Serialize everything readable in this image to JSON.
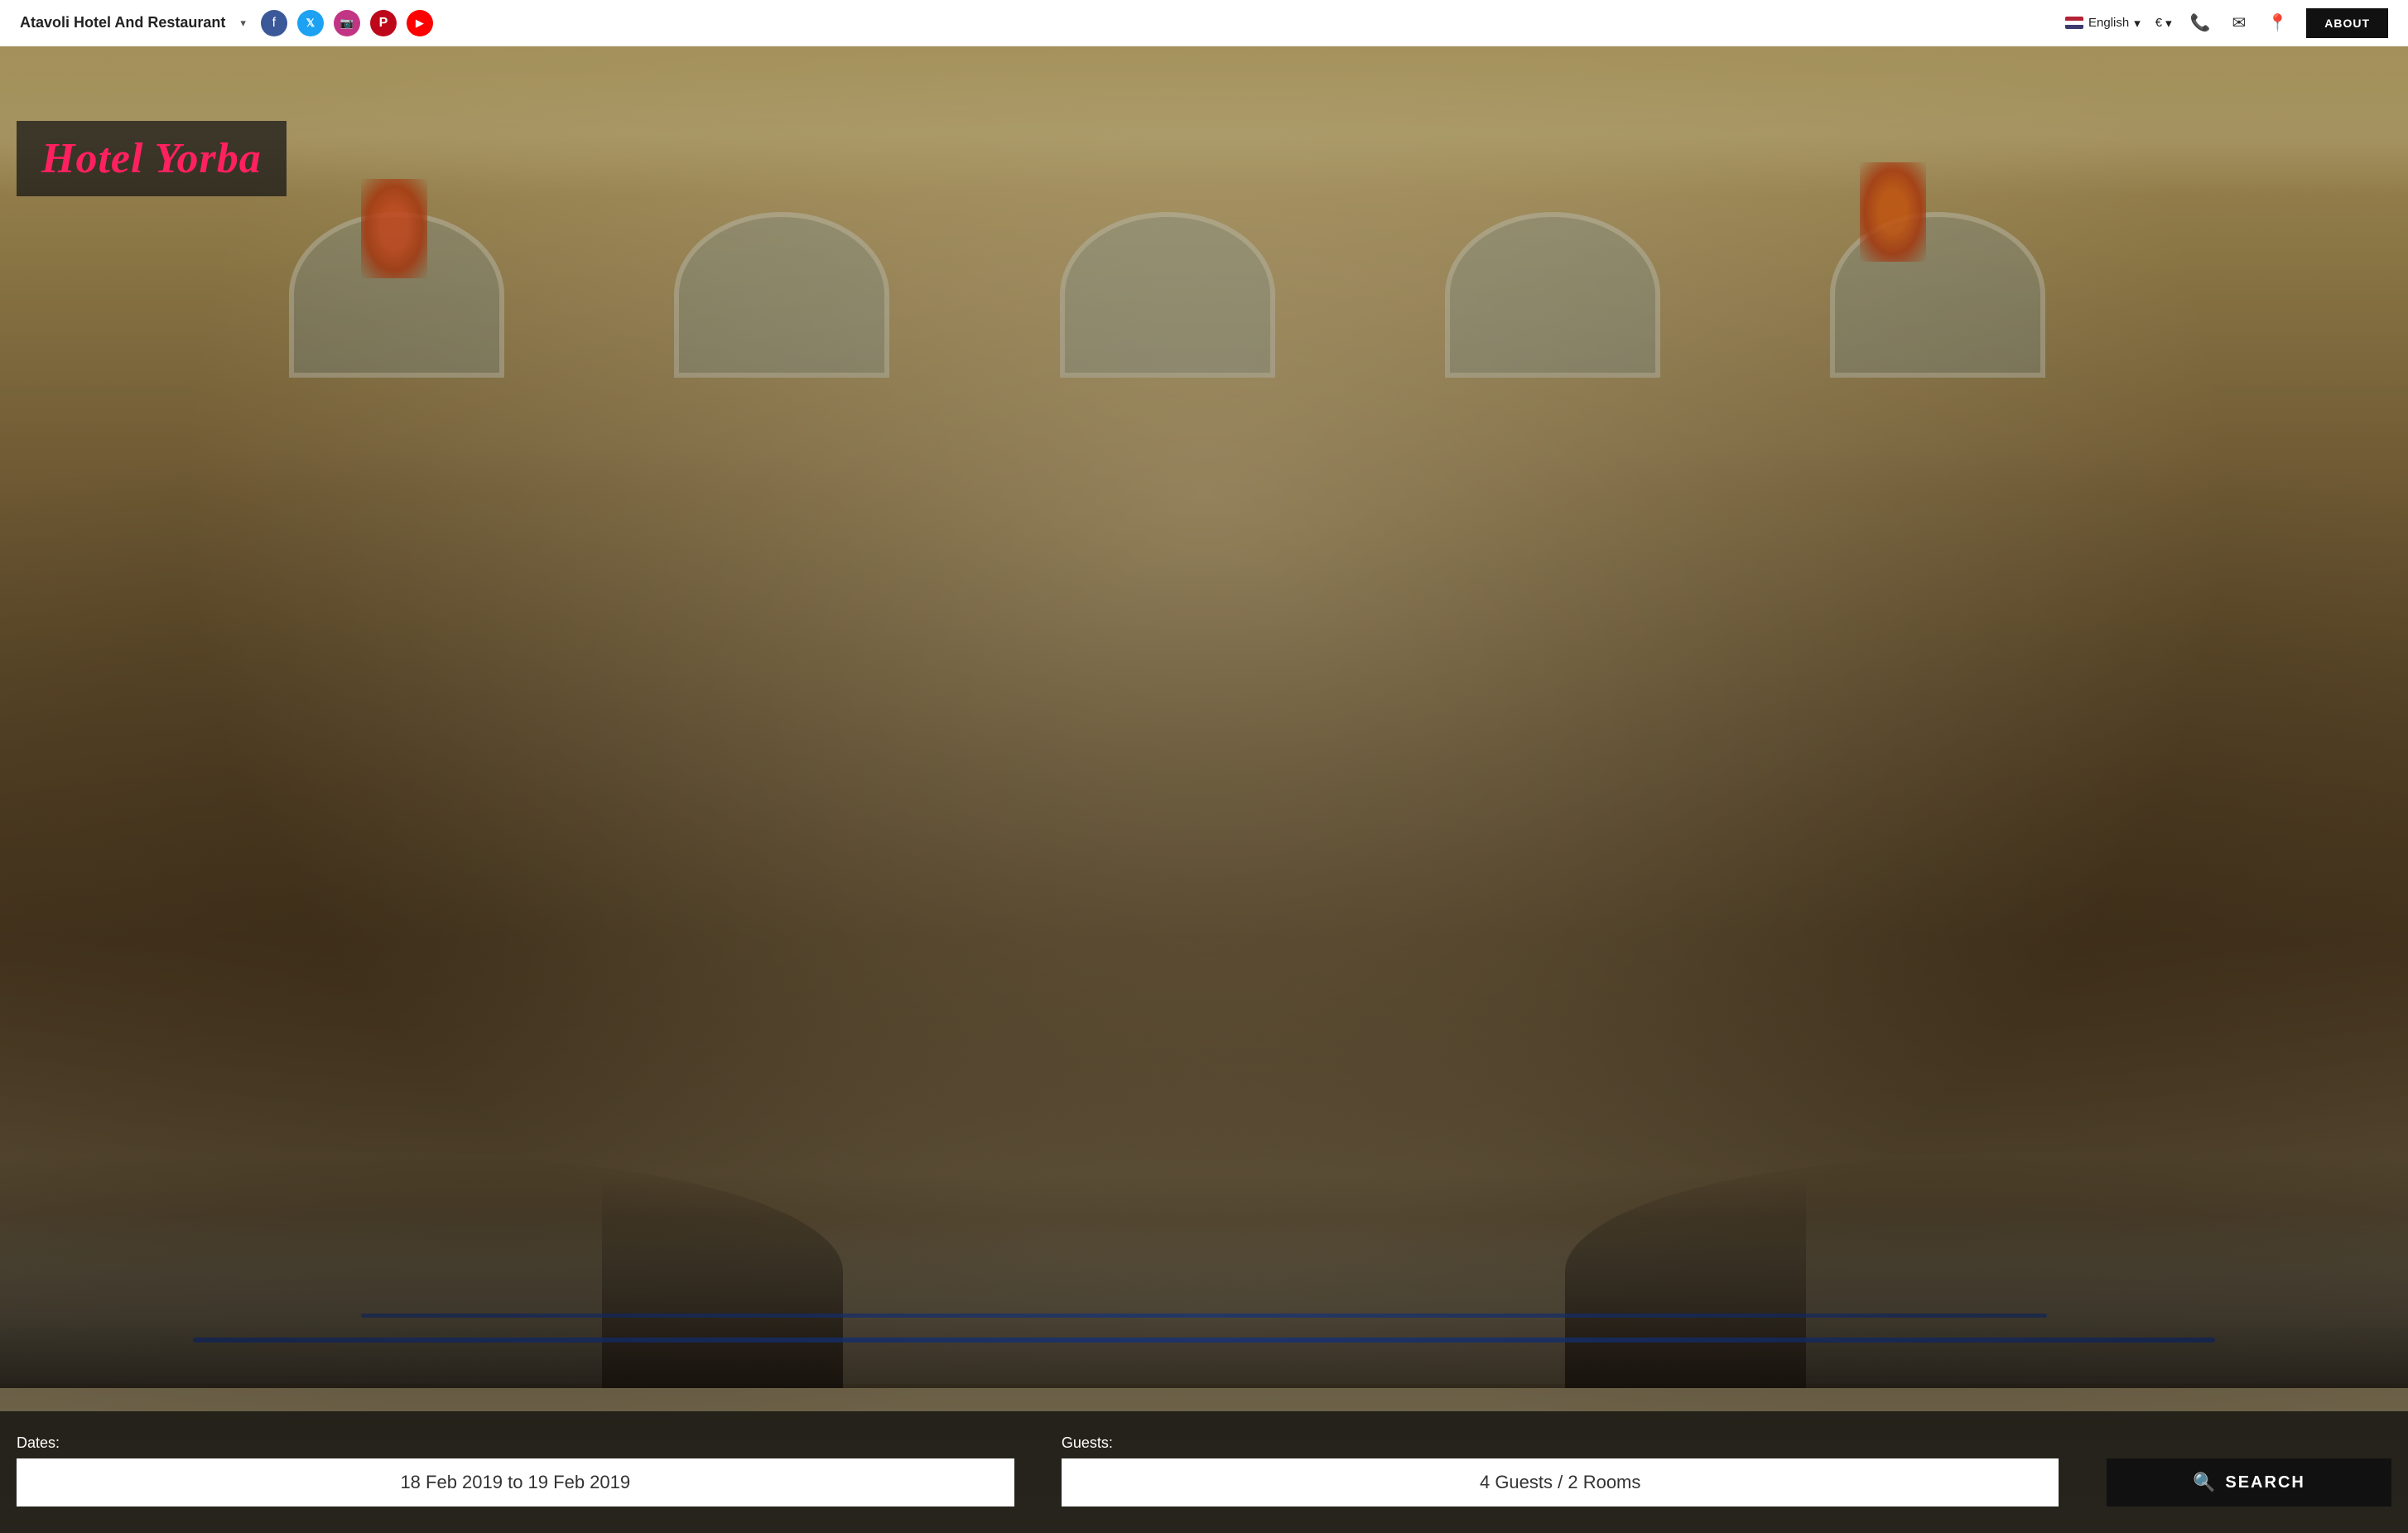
{
  "navbar": {
    "brand": "Atavoli Hotel And Restaurant",
    "brand_dropdown_symbol": "▾",
    "social": [
      {
        "name": "facebook",
        "label": "f",
        "class": "fb"
      },
      {
        "name": "twitter",
        "label": "𝕏",
        "class": "tw"
      },
      {
        "name": "instagram",
        "label": "📷",
        "class": "ig"
      },
      {
        "name": "pinterest",
        "label": "P",
        "class": "pt"
      },
      {
        "name": "youtube",
        "label": "▶",
        "class": "yt"
      }
    ],
    "language": "English",
    "language_dropdown": "▾",
    "currency": "€",
    "currency_dropdown": "▾",
    "about_label": "ABOUT"
  },
  "hero": {
    "hotel_name": "Hotel Yorba"
  },
  "search": {
    "dates_label": "Dates:",
    "guests_label": "Guests:",
    "dates_value": "18 Feb 2019 to 19 Feb 2019",
    "guests_value": "4 Guests / 2 Rooms",
    "search_button_label": "SEARCH",
    "search_icon": "🔍"
  }
}
